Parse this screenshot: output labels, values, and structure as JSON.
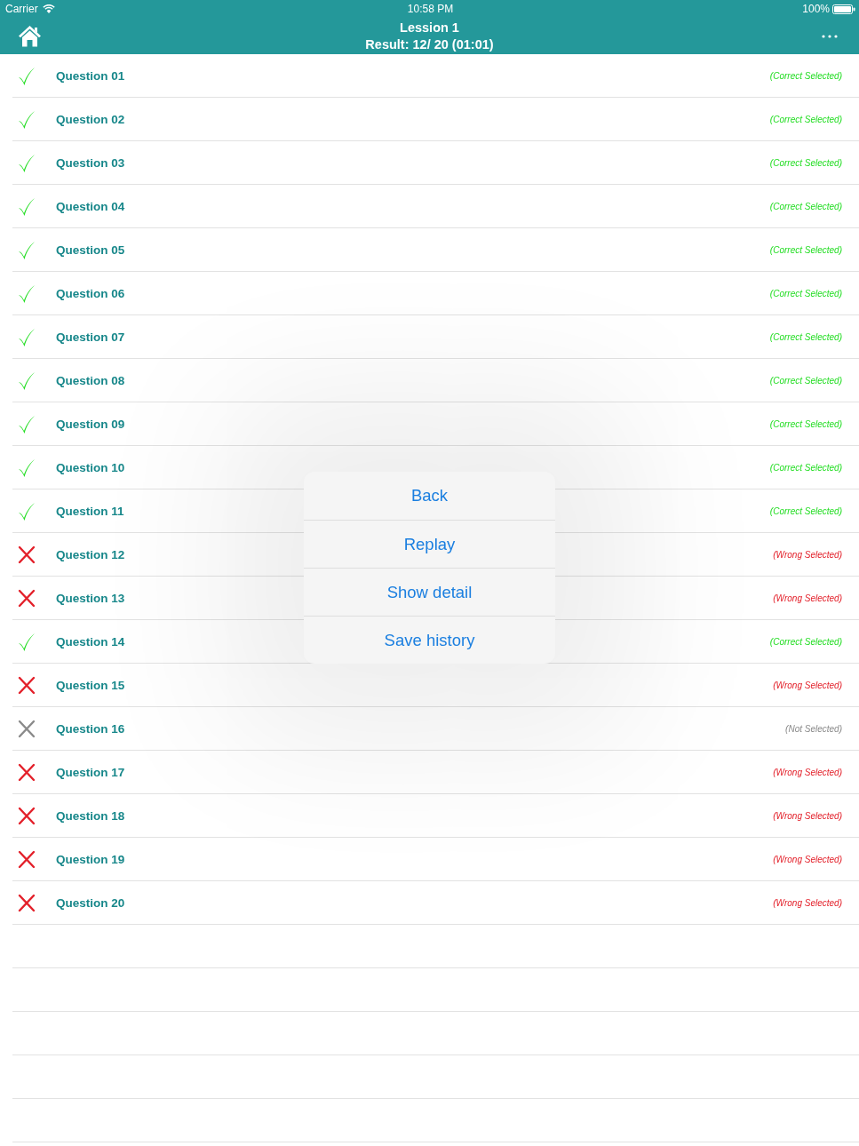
{
  "status_bar": {
    "carrier": "Carrier",
    "time": "10:58 PM",
    "battery": "100%"
  },
  "nav_bar": {
    "title": "Lession 1",
    "subtitle": "Result: 12/ 20 (01:01)"
  },
  "questions": [
    {
      "label": "Question 01",
      "kind": "correct",
      "status": "(Correct Selected)"
    },
    {
      "label": "Question 02",
      "kind": "correct",
      "status": "(Correct Selected)"
    },
    {
      "label": "Question 03",
      "kind": "correct",
      "status": "(Correct Selected)"
    },
    {
      "label": "Question 04",
      "kind": "correct",
      "status": "(Correct Selected)"
    },
    {
      "label": "Question 05",
      "kind": "correct",
      "status": "(Correct Selected)"
    },
    {
      "label": "Question 06",
      "kind": "correct",
      "status": "(Correct Selected)"
    },
    {
      "label": "Question 07",
      "kind": "correct",
      "status": "(Correct Selected)"
    },
    {
      "label": "Question 08",
      "kind": "correct",
      "status": "(Correct Selected)"
    },
    {
      "label": "Question 09",
      "kind": "correct",
      "status": "(Correct Selected)"
    },
    {
      "label": "Question 10",
      "kind": "correct",
      "status": "(Correct Selected)"
    },
    {
      "label": "Question 11",
      "kind": "correct",
      "status": "(Correct Selected)"
    },
    {
      "label": "Question 12",
      "kind": "wrong",
      "status": "(Wrong Selected)"
    },
    {
      "label": "Question 13",
      "kind": "wrong",
      "status": "(Wrong Selected)"
    },
    {
      "label": "Question 14",
      "kind": "correct",
      "status": "(Correct Selected)"
    },
    {
      "label": "Question 15",
      "kind": "wrong",
      "status": "(Wrong Selected)"
    },
    {
      "label": "Question 16",
      "kind": "unanswered",
      "status": "(Not Selected)"
    },
    {
      "label": "Question 17",
      "kind": "wrong",
      "status": "(Wrong Selected)"
    },
    {
      "label": "Question 18",
      "kind": "wrong",
      "status": "(Wrong Selected)"
    },
    {
      "label": "Question 19",
      "kind": "wrong",
      "status": "(Wrong Selected)"
    },
    {
      "label": "Question 20",
      "kind": "wrong",
      "status": "(Wrong Selected)"
    }
  ],
  "action_menu": {
    "items": [
      "Back",
      "Replay",
      "Show detail",
      "Save history"
    ]
  }
}
